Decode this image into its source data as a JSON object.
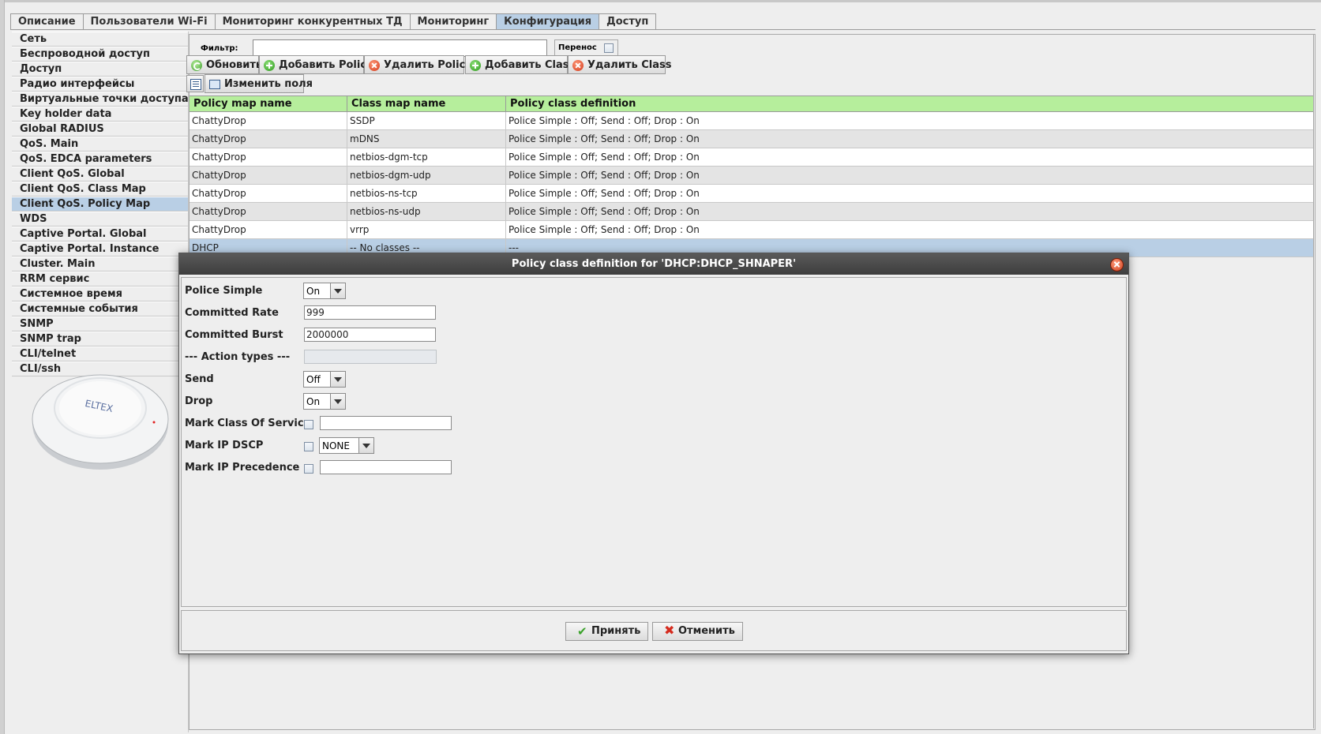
{
  "tabs": [
    {
      "label": "Описание",
      "active": false
    },
    {
      "label": "Пользователи Wi-Fi",
      "active": false
    },
    {
      "label": "Мониторинг конкурентных ТД",
      "active": false
    },
    {
      "label": "Мониторинг",
      "active": false
    },
    {
      "label": "Конфигурация",
      "active": true
    },
    {
      "label": "Доступ",
      "active": false
    }
  ],
  "sidebar": {
    "items": [
      "Сеть",
      "Беспроводной доступ",
      "Доступ",
      "Радио интерфейсы",
      "Виртуальные точки доступа",
      "Key holder data",
      "Global RADIUS",
      "QoS. Main",
      "QoS. EDCA parameters",
      "Client QoS. Global",
      "Client QoS. Class Map",
      "Client QoS. Policy Map",
      "WDS",
      "Captive Portal. Global",
      "Captive Portal. Instance",
      "Cluster. Main",
      "RRM сервис",
      "Системное время",
      "Системные события",
      "SNMP",
      "SNMP trap",
      "CLI/telnet",
      "CLI/ssh"
    ],
    "active_index": 11,
    "device_logo": "ELTEX"
  },
  "toolbar": {
    "filter_label": "Фильтр:",
    "filter_value": "",
    "wrap_label": "Перенос",
    "refresh": "Обновить",
    "add_policy": "Добавить Policy",
    "delete_policy": "Удалить Policy",
    "add_class": "Добавить Class",
    "delete_class": "Удалить Class",
    "edit_fields": "Изменить поля"
  },
  "table": {
    "headers": [
      "Policy map name",
      "Class map name",
      "Policy class definition"
    ],
    "rows": [
      [
        "ChattyDrop",
        "SSDP",
        "Police Simple : Off; Send : Off; Drop : On"
      ],
      [
        "ChattyDrop",
        "mDNS",
        "Police Simple : Off; Send : Off; Drop : On"
      ],
      [
        "ChattyDrop",
        "netbios-dgm-tcp",
        "Police Simple : Off; Send : Off; Drop : On"
      ],
      [
        "ChattyDrop",
        "netbios-dgm-udp",
        "Police Simple : Off; Send : Off; Drop : On"
      ],
      [
        "ChattyDrop",
        "netbios-ns-tcp",
        "Police Simple : Off; Send : Off; Drop : On"
      ],
      [
        "ChattyDrop",
        "netbios-ns-udp",
        "Police Simple : Off; Send : Off; Drop : On"
      ],
      [
        "ChattyDrop",
        "vrrp",
        "Police Simple : Off; Send : Off; Drop : On"
      ],
      [
        "DHCP",
        "-- No classes --",
        "---"
      ]
    ],
    "selected_index": 7
  },
  "dialog": {
    "title": "Policy class definition for 'DHCP:DHCP_SHNAPER'",
    "police_simple_label": "Police Simple",
    "police_simple_value": "On",
    "committed_rate_label": "Committed Rate",
    "committed_rate_value": "999",
    "committed_burst_label": "Committed Burst",
    "committed_burst_value": "2000000",
    "action_types_label": "--- Action types ---",
    "send_label": "Send",
    "send_value": "Off",
    "drop_label": "Drop",
    "drop_value": "On",
    "mark_cos_label": "Mark Class Of Service",
    "mark_dscp_label": "Mark IP DSCP",
    "mark_dscp_value": "NONE",
    "mark_precedence_label": "Mark IP Precedence",
    "accept": "Принять",
    "cancel": "Отменить"
  },
  "colors": {
    "header_green": "#b6ee9c",
    "selection_blue": "#b9cfe5",
    "title_bar": "#444444"
  }
}
